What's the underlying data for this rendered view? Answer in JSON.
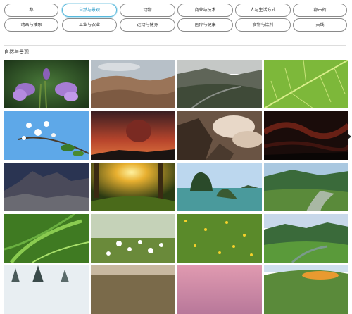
{
  "categories": [
    {
      "label": "都",
      "active": false
    },
    {
      "label": "自然与景观",
      "active": true
    },
    {
      "label": "动物",
      "active": false
    },
    {
      "label": "商业与技术",
      "active": false
    },
    {
      "label": "人与生活方式",
      "active": false
    },
    {
      "label": "都市的",
      "active": false
    },
    {
      "label": "动画与抽象",
      "active": false
    },
    {
      "label": "工业与农业",
      "active": false
    },
    {
      "label": "运动与健身",
      "active": false
    },
    {
      "label": "医疗与健康",
      "active": false
    },
    {
      "label": "食物与饮料",
      "active": false
    },
    {
      "label": "天线",
      "active": false
    }
  ],
  "section": {
    "title": "自然与景观"
  },
  "thumbnails": [
    {
      "name": "purple-flowers-thumbnail"
    },
    {
      "name": "desert-canyon-thumbnail"
    },
    {
      "name": "valley-river-thumbnail"
    },
    {
      "name": "green-leaf-thumbnail"
    },
    {
      "name": "white-blossoms-thumbnail"
    },
    {
      "name": "volcano-eruption-thumbnail"
    },
    {
      "name": "rocky-clouds-thumbnail"
    },
    {
      "name": "aurora-night-thumbnail"
    },
    {
      "name": "mountain-ridge-thumbnail"
    },
    {
      "name": "forest-sunrise-thumbnail"
    },
    {
      "name": "karst-islands-thumbnail"
    },
    {
      "name": "river-valley-thumbnail"
    },
    {
      "name": "grass-blades-thumbnail"
    },
    {
      "name": "daisy-field-thumbnail"
    },
    {
      "name": "dandelion-meadow-thumbnail"
    },
    {
      "name": "green-hills-river-thumbnail"
    },
    {
      "name": "snowy-trees-thumbnail"
    },
    {
      "name": "sunset-plains-thumbnail"
    },
    {
      "name": "pink-sky-thumbnail"
    },
    {
      "name": "flower-hills-thumbnail"
    }
  ],
  "icons": {
    "next": "chevron-right-icon"
  }
}
